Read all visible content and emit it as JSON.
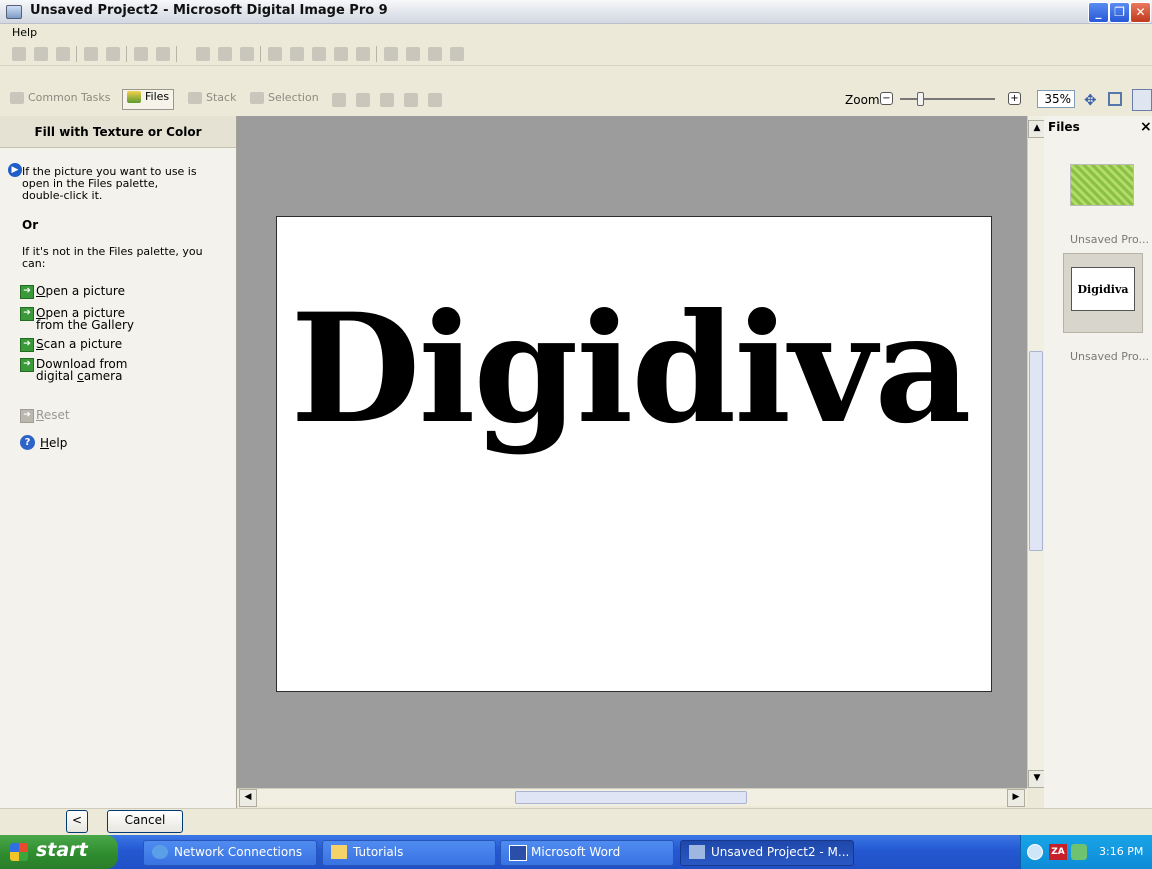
{
  "window": {
    "title": "Unsaved Project2 - Microsoft Digital Image Pro 9",
    "minimize": "_",
    "restore": "❐",
    "close": "✕"
  },
  "menu": {
    "help": "Help"
  },
  "tabs": {
    "common_tasks": "Common Tasks",
    "files": "Files",
    "stack": "Stack",
    "selection": "Selection"
  },
  "zoom": {
    "label": "Zoom",
    "minus": "−",
    "plus": "+",
    "value": "35%"
  },
  "task_pane": {
    "title": "Fill with Texture or Color",
    "intro": "If the picture you want to use is open in the Files palette, double-click it.",
    "or": "Or",
    "alt": "If it's not in the Files palette, you can:",
    "links": {
      "open_a": "O",
      "open_b": "pen a picture",
      "gallery_a": "O",
      "gallery_b": "pen a picture",
      "gallery_c": "from the Gallery",
      "scan_a": "S",
      "scan_b": "can a picture",
      "download_a": "Download from",
      "download_b": "digital ",
      "download_c": "c",
      "download_d": "amera",
      "reset_a": "R",
      "reset_b": "eset",
      "help_a": "H",
      "help_b": "elp"
    }
  },
  "canvas": {
    "text": "Digidiva"
  },
  "files_palette": {
    "title": "Files",
    "close": "×",
    "items": [
      {
        "label": "Unsaved Pro..."
      },
      {
        "label": "Unsaved Pro...",
        "thumb_text": "Digidiva"
      }
    ]
  },
  "bottom": {
    "back": "<",
    "cancel": "Cancel"
  },
  "taskbar": {
    "start": "start",
    "tasks": [
      "Network Connections",
      "Tutorials",
      "Microsoft Word",
      "Unsaved Project2 - M..."
    ],
    "clock": "3:16 PM"
  }
}
